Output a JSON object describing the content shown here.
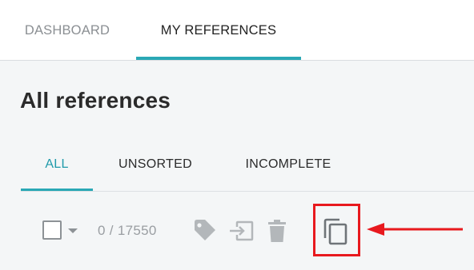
{
  "top_nav": {
    "tabs": [
      {
        "label": "DASHBOARD",
        "active": false
      },
      {
        "label": "MY REFERENCES",
        "active": true
      }
    ]
  },
  "page": {
    "title": "All references"
  },
  "sub_tabs": [
    {
      "label": "ALL",
      "active": true
    },
    {
      "label": "UNSORTED",
      "active": false
    },
    {
      "label": "INCOMPLETE",
      "active": false
    }
  ],
  "toolbar": {
    "selection_count": "0 / 17550",
    "icons": [
      "checkbox-icon",
      "caret-down-icon",
      "tag-icon",
      "move-to-icon",
      "trash-icon",
      "copy-icon"
    ]
  },
  "annotation": {
    "highlight_color": "#e8191e"
  },
  "colors": {
    "accent": "#2aa8b5",
    "active_tab_text": "#1f9aaa",
    "icon_gray": "#b3b7ba",
    "background": "#f4f6f7"
  }
}
